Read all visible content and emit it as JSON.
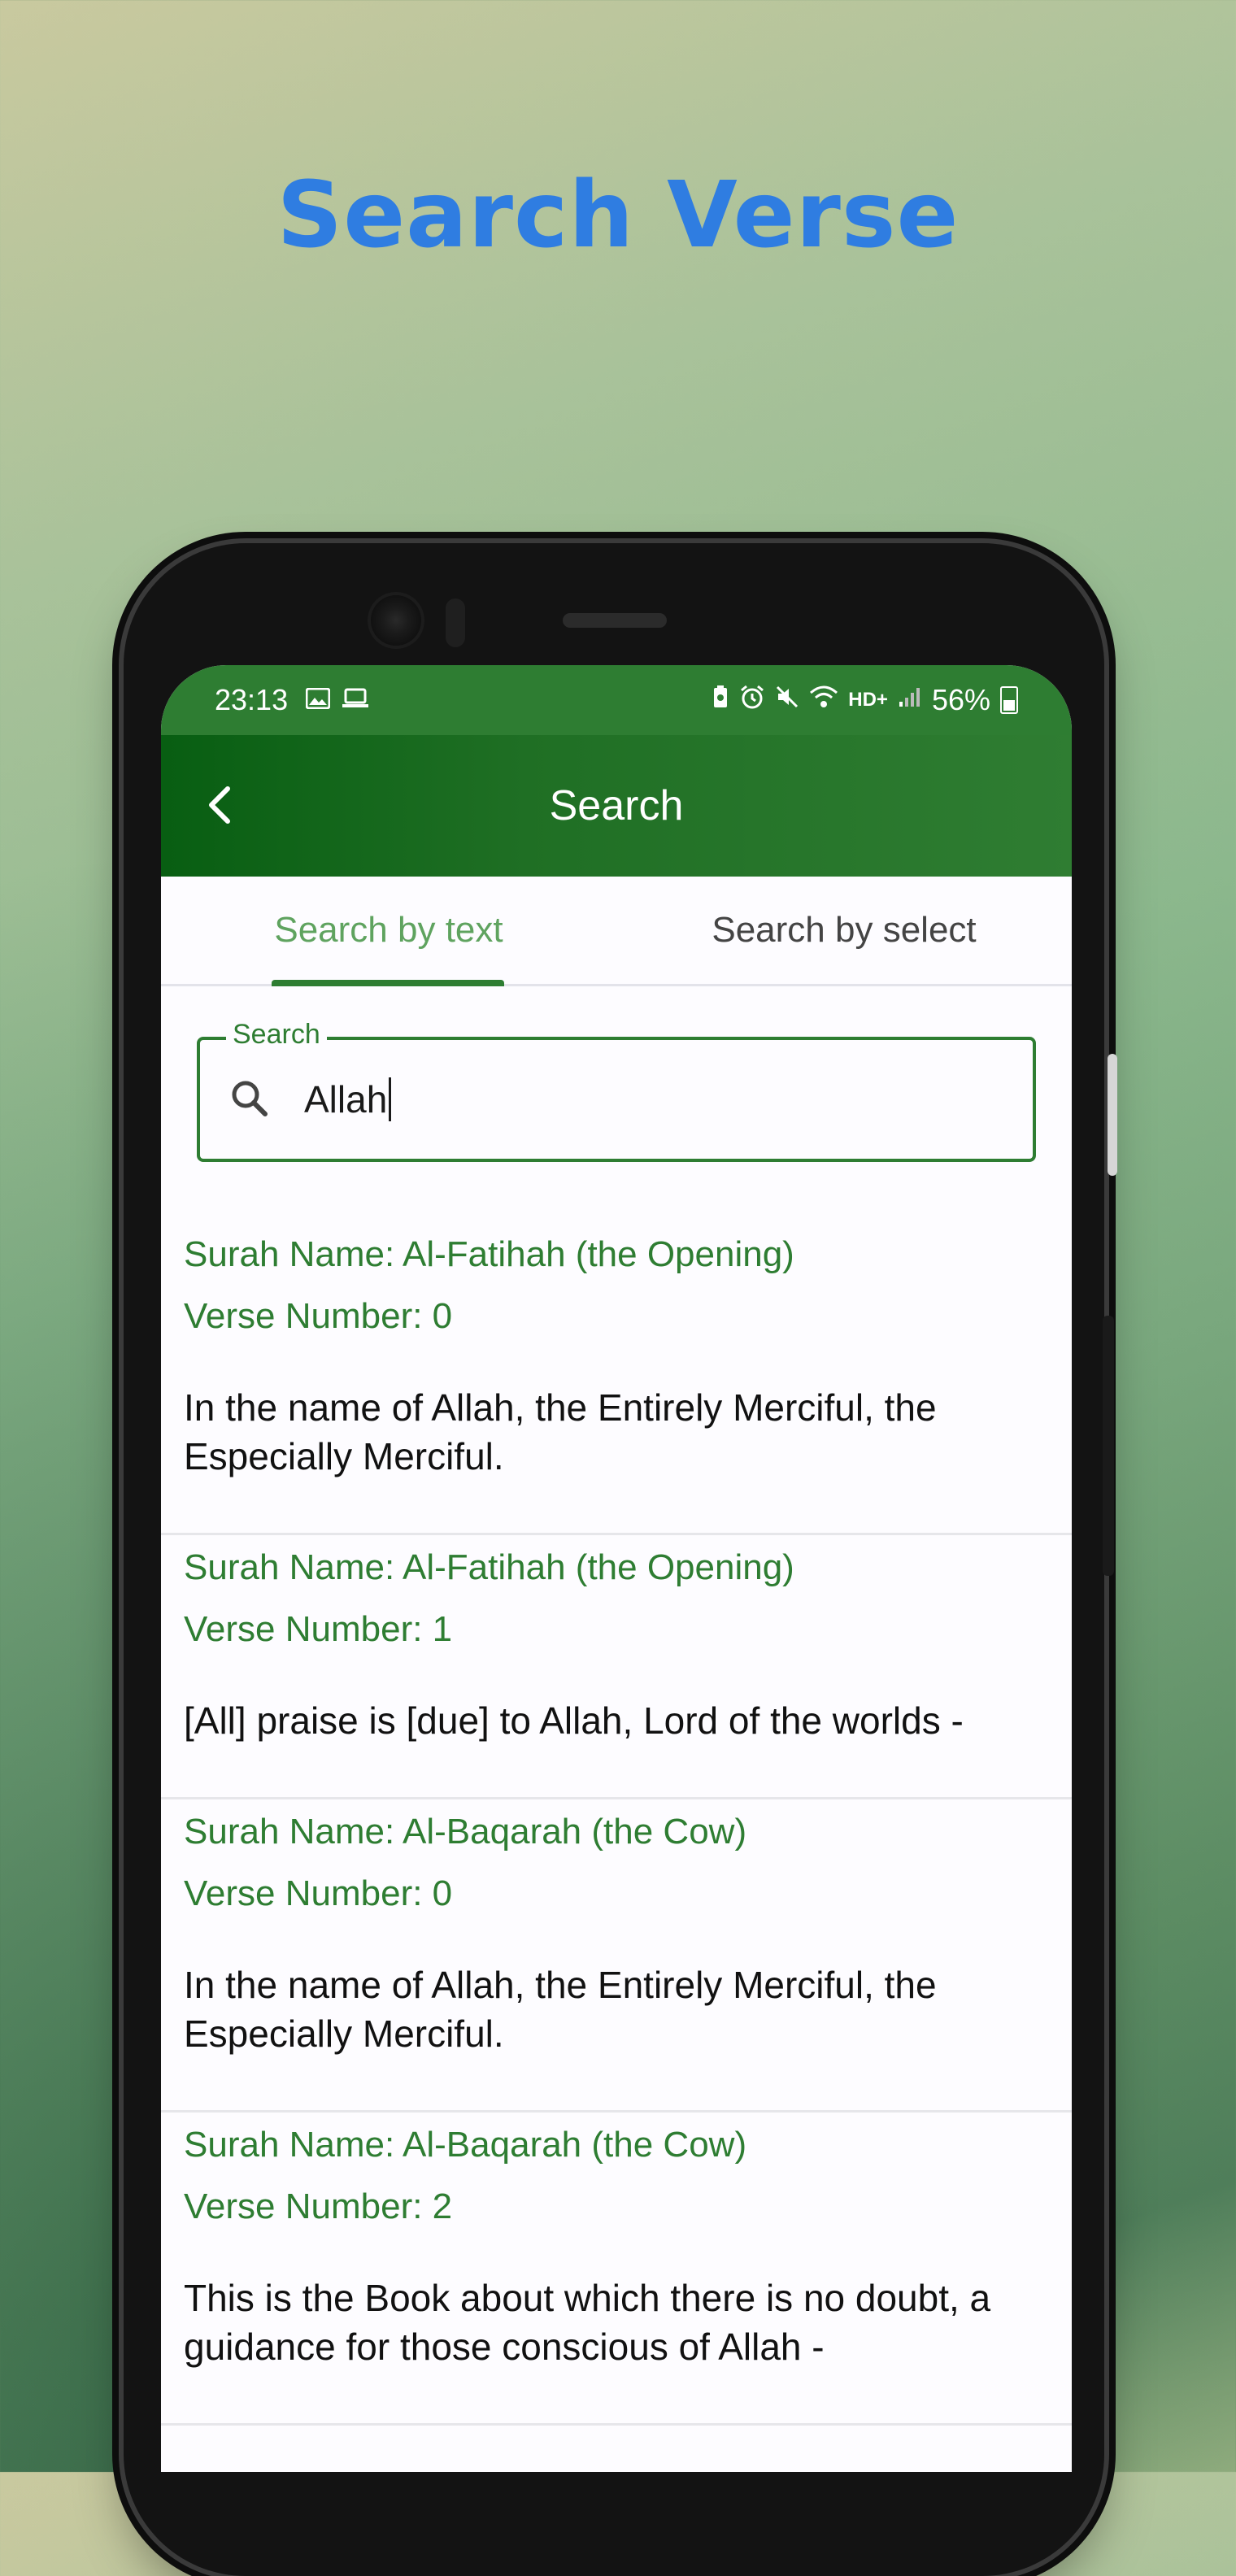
{
  "headline": "Search Verse",
  "status_bar": {
    "time": "23:13",
    "left_icons": [
      "image-icon",
      "laptop-icon"
    ],
    "right_icons": [
      "battery-saver-icon",
      "alarm-icon",
      "mute-icon",
      "wifi-icon"
    ],
    "network": "HD+",
    "battery": "56%"
  },
  "app_bar": {
    "title": "Search"
  },
  "tabs": [
    {
      "label": "Search by text",
      "active": true
    },
    {
      "label": "Search by select",
      "active": false
    }
  ],
  "search": {
    "label": "Search",
    "value": "Allah"
  },
  "results": [
    {
      "surah": "Surah Name: Al-Fatihah (the Opening)",
      "verse": "Verse Number: 0",
      "text": "In the name of Allah, the Entirely Merciful, the Especially Merciful."
    },
    {
      "surah": "Surah Name: Al-Fatihah (the Opening)",
      "verse": "Verse Number: 1",
      "text": "[All] praise is [due] to Allah, Lord of the worlds -"
    },
    {
      "surah": "Surah Name: Al-Baqarah (the Cow)",
      "verse": "Verse Number: 0",
      "text": "In the name of Allah, the Entirely Merciful, the Especially Merciful."
    },
    {
      "surah": "Surah Name: Al-Baqarah (the Cow)",
      "verse": "Verse Number: 2",
      "text": "This is the Book about which there is no doubt, a guidance for those conscious of Allah -"
    }
  ],
  "colors": {
    "primary": "#2e7d32",
    "headline": "#2f7de1",
    "inactive_tab": "#444444"
  }
}
